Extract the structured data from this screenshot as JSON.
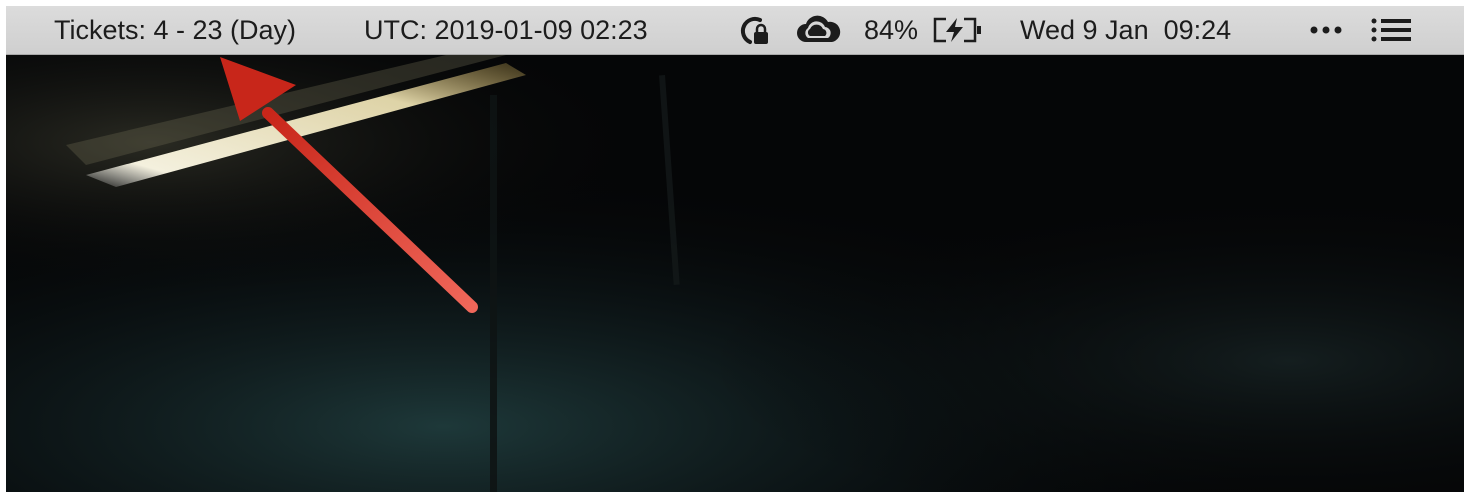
{
  "menubar": {
    "tickets_label": "Tickets: 4 - 23 (Day)",
    "utc_label": "UTC: 2019-01-09 02:23",
    "lock_icon": "sync-lock-icon",
    "cloud_icon": "cloud-icon",
    "battery_percent": "84%",
    "battery_icon": "battery-charging-icon",
    "datetime": "Wed 9 Jan  09:24",
    "more_icon": "more-dots-icon",
    "notification_icon": "list-icon"
  },
  "colors": {
    "menubar_bg": "#d6d6d6",
    "arrow": "#d93a2b",
    "desktop_bg": "#050607"
  }
}
